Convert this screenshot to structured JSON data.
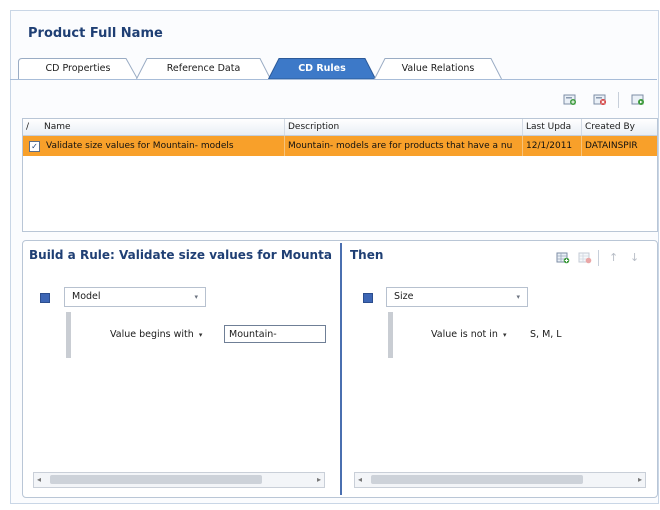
{
  "page": {
    "title": "Product Full Name"
  },
  "tabs": [
    {
      "label": "CD Properties",
      "active": false
    },
    {
      "label": "Reference Data",
      "active": false
    },
    {
      "label": "CD Rules",
      "active": true
    },
    {
      "label": "Value Relations",
      "active": false
    }
  ],
  "toolbar": {
    "icons": [
      "add-rule-icon",
      "delete-rule-icon",
      "run-rule-icon"
    ]
  },
  "grid": {
    "columns": [
      "/",
      "Name",
      "Description",
      "Last Upda",
      "Created By"
    ],
    "rows": [
      {
        "checked": true,
        "check_glyph": "✓",
        "name": "Validate size values for Mountain- models",
        "description": "Mountain- models are for products that have a nu",
        "last_updated": "12/1/2011",
        "created_by": "DATAINSPIR",
        "selected": true
      }
    ]
  },
  "builder": {
    "if_title": "Build a Rule: Validate size values for Mounta",
    "then_title": "Then",
    "if": {
      "field": "Model",
      "operator": "Value begins with",
      "value": "Mountain-"
    },
    "then": {
      "field": "Size",
      "operator": "Value is not in",
      "value": "S, M, L"
    },
    "toolbar_icons": [
      "add-condition-icon",
      "remove-condition-icon",
      "move-up-icon",
      "move-down-icon"
    ],
    "glyphs": {
      "dropdown": "▾",
      "up": "↑",
      "down": "↓",
      "left": "◂",
      "right": "▸"
    }
  },
  "colors": {
    "accent": "#1f3f74",
    "selection": "#f8a02a",
    "active_tab": "#3d79c8"
  }
}
